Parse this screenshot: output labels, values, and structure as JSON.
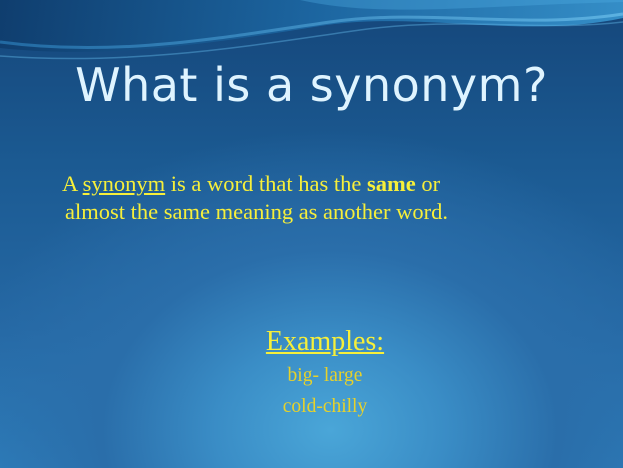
{
  "slide": {
    "title": "What is a synonym?",
    "definition": {
      "part1": "A ",
      "term": "synonym",
      "part2": " is a word that has the ",
      "emphasis": "same",
      "part3": " or",
      "line2": "almost the same meaning as another word."
    },
    "examples_heading": "Examples:",
    "examples": [
      "big- large",
      "cold-chilly"
    ]
  },
  "colors": {
    "title": "#dff4ff",
    "body_text": "#f6ef3a",
    "background_top": "#15467a",
    "background_glow": "#4aa6d8"
  }
}
